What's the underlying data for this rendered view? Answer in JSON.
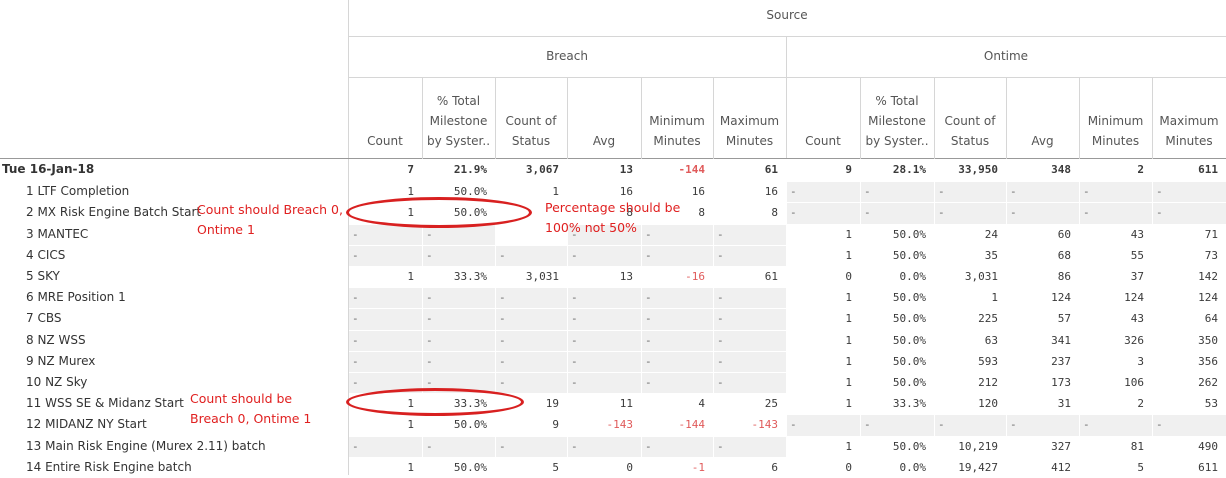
{
  "header": {
    "source": "Source",
    "breach": "Breach",
    "ontime": "Ontime",
    "columns": [
      "Count",
      "% Total Milestone by Syster..",
      "Count of Status",
      "Avg",
      "Minimum Minutes",
      "Maximum Minutes",
      "Count",
      "% Total Milestone by Syster..",
      "Count of Status",
      "Avg",
      "Minimum Minutes",
      "Maximum Minutes"
    ]
  },
  "rows": [
    {
      "label": "Tue 16-Jan-18",
      "cells": [
        "7",
        "21.9%",
        "3,067",
        "13",
        "-144",
        "61",
        "9",
        "28.1%",
        "33,950",
        "348",
        "2",
        "611"
      ],
      "total": true
    },
    {
      "label": "1 LTF Completion",
      "cells": [
        "1",
        "50.0%",
        "1",
        "16",
        "16",
        "16",
        "-",
        "-",
        "-",
        "-",
        "-",
        "-"
      ]
    },
    {
      "label": "2 MX Risk Engine Batch Start",
      "cells": [
        "1",
        "50.0%",
        "",
        "8",
        "8",
        "8",
        "-",
        "-",
        "-",
        "-",
        "-",
        "-"
      ]
    },
    {
      "label": "3 MANTEC",
      "cells": [
        "-",
        "-",
        "",
        "-",
        "-",
        "-",
        "1",
        "50.0%",
        "24",
        "60",
        "43",
        "71"
      ]
    },
    {
      "label": "4 CICS",
      "cells": [
        "-",
        "-",
        "-",
        "-",
        "-",
        "-",
        "1",
        "50.0%",
        "35",
        "68",
        "55",
        "73"
      ]
    },
    {
      "label": "5 SKY",
      "cells": [
        "1",
        "33.3%",
        "3,031",
        "13",
        "-16",
        "61",
        "0",
        "0.0%",
        "3,031",
        "86",
        "37",
        "142"
      ]
    },
    {
      "label": "6 MRE Position 1",
      "cells": [
        "-",
        "-",
        "-",
        "-",
        "-",
        "-",
        "1",
        "50.0%",
        "1",
        "124",
        "124",
        "124"
      ]
    },
    {
      "label": "7 CBS",
      "cells": [
        "-",
        "-",
        "-",
        "-",
        "-",
        "-",
        "1",
        "50.0%",
        "225",
        "57",
        "43",
        "64"
      ]
    },
    {
      "label": "8 NZ WSS",
      "cells": [
        "-",
        "-",
        "-",
        "-",
        "-",
        "-",
        "1",
        "50.0%",
        "63",
        "341",
        "326",
        "350"
      ]
    },
    {
      "label": "9 NZ Murex",
      "cells": [
        "-",
        "-",
        "-",
        "-",
        "-",
        "-",
        "1",
        "50.0%",
        "593",
        "237",
        "3",
        "356"
      ]
    },
    {
      "label": "10 NZ Sky",
      "cells": [
        "-",
        "-",
        "-",
        "-",
        "-",
        "-",
        "1",
        "50.0%",
        "212",
        "173",
        "106",
        "262"
      ]
    },
    {
      "label": "11 WSS SE & Midanz Start",
      "cells": [
        "1",
        "33.3%",
        "19",
        "11",
        "4",
        "25",
        "1",
        "33.3%",
        "120",
        "31",
        "2",
        "53"
      ]
    },
    {
      "label": "12 MIDANZ NY Start",
      "cells": [
        "1",
        "50.0%",
        "9",
        "-143",
        "-144",
        "-143",
        "-",
        "-",
        "-",
        "-",
        "-",
        "-"
      ]
    },
    {
      "label": "13 Main Risk Engine (Murex 2.11) batch",
      "cells": [
        "-",
        "-",
        "-",
        "-",
        "-",
        "-",
        "1",
        "50.0%",
        "10,219",
        "327",
        "81",
        "490"
      ]
    },
    {
      "label": "14 Entire Risk Engine batch",
      "cells": [
        "1",
        "50.0%",
        "5",
        "0",
        "-1",
        "6",
        "0",
        "0.0%",
        "19,427",
        "412",
        "5",
        "611"
      ]
    }
  ],
  "annotations": {
    "note1_l1": "Count should Breach 0,",
    "note1_l2": "Ontime 1",
    "note2_l1": "Percentage should be",
    "note2_l2": "100% not 50%",
    "note3_l1": "Count should be",
    "note3_l2": "Breach 0, Ontime 1"
  },
  "colors": {
    "negative": "#e05a5a",
    "annotation": "#e02020"
  }
}
